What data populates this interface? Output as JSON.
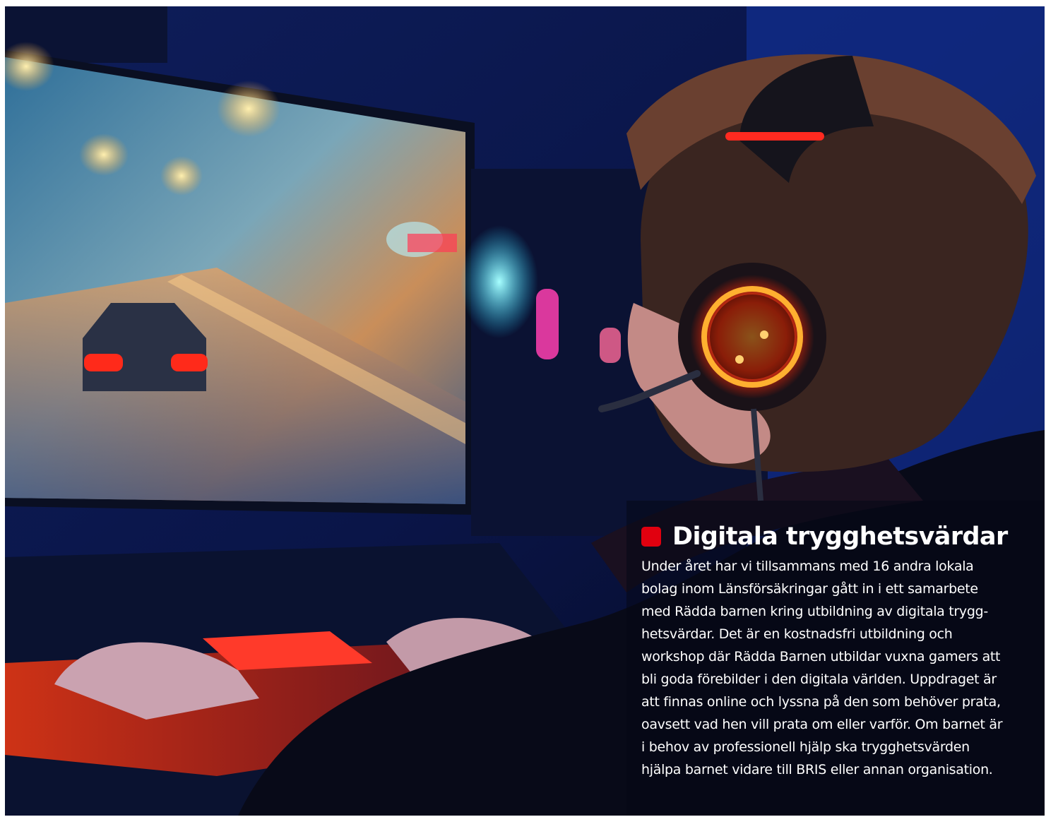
{
  "photo": {
    "description_icon": "gaming-photo-icon",
    "accent_color": "#e1000f"
  },
  "caption": {
    "heading": "Digitala trygghetsvärdar",
    "body_lines": [
      "Under året har vi tillsammans med 16 andra lokala",
      "bolag inom Länsförsäkringar gått in i ett samarbete",
      "med Rädda barnen kring utbildning av digitala trygg-",
      "hetsvärdar. Det är en kostnadsfri utbildning och",
      "workshop där Rädda Barnen utbildar vuxna gamers att",
      "bli goda förebilder i den digitala världen. Uppdraget är",
      "att finnas online och lyssna på den som behöver prata,",
      "oavsett vad hen vill prata om eller varför. Om barnet är",
      "i behov av professionell hjälp ska trygghetsvärden",
      "hjälpa barnet vidare till BRIS eller annan organisation."
    ]
  }
}
